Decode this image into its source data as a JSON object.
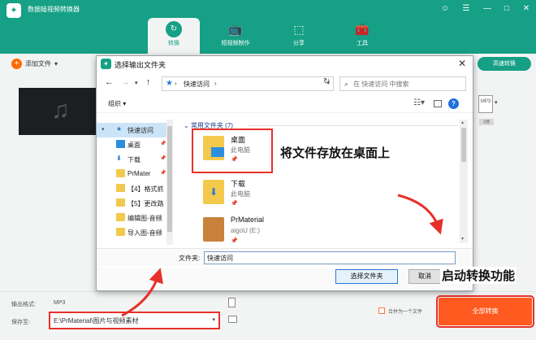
{
  "app": {
    "title": "数据蛙视频转换器",
    "window_controls": [
      "☺",
      "☰",
      "—",
      "□",
      "✕"
    ],
    "brand_color": "#16a085",
    "accent_color": "#ff5a1f",
    "nav_tabs": [
      {
        "label": "转换",
        "icon": "convert-icon",
        "glyph": "↻",
        "active": true
      },
      {
        "label": "短视频制作",
        "icon": "tv-icon",
        "glyph": "📺",
        "active": false
      },
      {
        "label": "分享",
        "icon": "share-icon",
        "glyph": "⬚",
        "active": false
      },
      {
        "label": "工具",
        "icon": "toolbox-icon",
        "glyph": "🧰",
        "active": false
      }
    ],
    "add_file": {
      "plus": "+",
      "label": "添加文件",
      "caret": "▾"
    },
    "speed_button": "高速转换",
    "thumbnail_icon": "♫",
    "format_icon": {
      "label": "MP3",
      "caret": "▾",
      "sub": "设置"
    },
    "output_format": {
      "label": "输出格式:",
      "value": "MP3"
    },
    "save_to": {
      "label": "保存至:",
      "path": "E:\\PrMaterial\\图片与视频素材",
      "caret": "▾"
    },
    "merge": {
      "label": "合并为一个文件"
    },
    "convert_all": "全部转换"
  },
  "dialog": {
    "title": "选择输出文件夹",
    "close": "✕",
    "nav": {
      "back": "←",
      "forward": "→",
      "dropdown": "▾",
      "up": "↑"
    },
    "address": {
      "pin": "★",
      "arrow": "›",
      "text": "快速访问",
      "after": "›",
      "caret": "▾"
    },
    "refresh": "↻",
    "search": {
      "icon": "⌕",
      "placeholder": "在 快速访问 中搜索"
    },
    "toolbar": {
      "organize": "组织 ▾",
      "view": "☷▾",
      "help": "?"
    },
    "nav_pane": [
      {
        "label": "快速访问",
        "icon": "star-icon",
        "glyph": "★",
        "selected": true,
        "expander": "▾",
        "pin": ""
      },
      {
        "label": "桌面",
        "icon": "desktop-icon",
        "glyph": "",
        "selected": false,
        "expander": "",
        "pin": "📌"
      },
      {
        "label": "下载",
        "icon": "download-icon",
        "glyph": "⬇",
        "selected": false,
        "expander": "",
        "pin": "📌"
      },
      {
        "label": "PrMater",
        "icon": "folder-icon",
        "glyph": "",
        "selected": false,
        "expander": "",
        "pin": "📌"
      },
      {
        "label": "【4】格式抓",
        "icon": "folder-icon",
        "glyph": "",
        "selected": false,
        "expander": "",
        "pin": ""
      },
      {
        "label": "【5】更改路",
        "icon": "folder-icon",
        "glyph": "",
        "selected": false,
        "expander": "",
        "pin": ""
      },
      {
        "label": "编辑图-音频",
        "icon": "folder-icon",
        "glyph": "",
        "selected": false,
        "expander": "",
        "pin": ""
      },
      {
        "label": "导入图-音频",
        "icon": "folder-icon",
        "glyph": "",
        "selected": false,
        "expander": "",
        "pin": ""
      }
    ],
    "group": {
      "arrow": "⌄",
      "label": "常用文件夹 (7)"
    },
    "entries": [
      {
        "name": "桌面",
        "sub": "此电脑",
        "pin": "📌",
        "kind": "desk"
      },
      {
        "name": "下载",
        "sub": "此电脑",
        "pin": "📌",
        "kind": "dl"
      },
      {
        "name": "PrMaterial",
        "sub": "aigoU (E:)",
        "pin": "📌",
        "kind": "pr"
      }
    ],
    "folder_label": "文件夹:",
    "folder_value": "快速访问",
    "select_button": "选择文件夹",
    "cancel_button": "取消"
  },
  "annotations": {
    "desktop_hint": "将文件存放在桌面上",
    "convert_hint": "启动转换功能",
    "color": "#e8302a"
  }
}
